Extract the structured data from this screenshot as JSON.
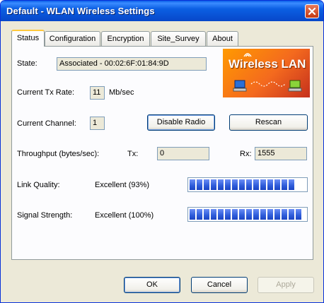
{
  "window": {
    "title": "Default - WLAN Wireless Settings"
  },
  "tabs": [
    {
      "label": "Status"
    },
    {
      "label": "Configuration"
    },
    {
      "label": "Encryption"
    },
    {
      "label": "Site_Survey"
    },
    {
      "label": "About"
    }
  ],
  "status": {
    "state_label": "State:",
    "state_value": "Associated - 00:02:6F:01:84:9D",
    "tx_rate_label": "Current Tx Rate:",
    "tx_rate_value": "11",
    "tx_rate_unit": "Mb/sec",
    "channel_label": "Current Channel:",
    "channel_value": "1",
    "disable_radio": "Disable Radio",
    "rescan": "Rescan",
    "throughput_label": "Throughput (bytes/sec):",
    "tx_label": "Tx:",
    "tx_value": "0",
    "rx_label": "Rx:",
    "rx_value": "1555",
    "link_quality_label": "Link Quality:",
    "link_quality_value": "Excellent (93%)",
    "link_quality_fraction": 0.93,
    "signal_label": "Signal Strength:",
    "signal_value": "Excellent (100%)",
    "signal_fraction": 1.0
  },
  "logo": {
    "text": "Wireless LAN"
  },
  "footer": {
    "ok": "OK",
    "cancel": "Cancel",
    "apply": "Apply"
  },
  "colors": {
    "title_bar": "#0b5fe3",
    "progress": "#2d5bd9",
    "logo_bg": "#f46a1e"
  }
}
